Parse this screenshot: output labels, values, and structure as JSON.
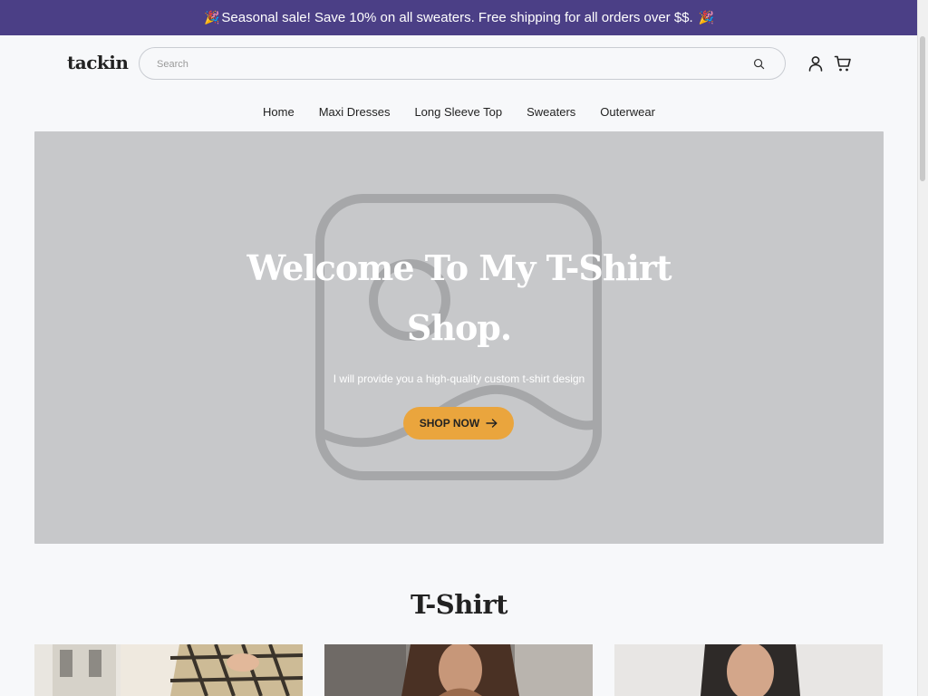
{
  "announcement": {
    "text": "Seasonal sale! Save 10% on all sweaters. Free shipping for all orders over $$.",
    "icon_left": "party-popper-icon",
    "icon_right": "party-popper-icon"
  },
  "header": {
    "logo": "tackin",
    "search": {
      "placeholder": "Search",
      "value": ""
    },
    "icons": [
      "search-icon",
      "account-icon",
      "cart-icon"
    ]
  },
  "nav": {
    "items": [
      {
        "label": "Home"
      },
      {
        "label": "Maxi Dresses"
      },
      {
        "label": "Long Sleeve Top"
      },
      {
        "label": "Sweaters"
      },
      {
        "label": "Outerwear"
      }
    ]
  },
  "hero": {
    "title_line1": "Welcome To My T-Shirt",
    "title_line2": "Shop.",
    "subtitle": "I will provide you a high-quality custom t-shirt design",
    "cta_label": "SHOP NOW",
    "cta_icon": "arrow-right-icon",
    "background_icon": "image-placeholder-icon"
  },
  "collection": {
    "title": "T-Shirt",
    "products": [
      {
        "image": "plaid-shirt-photo"
      },
      {
        "image": "brown-top-photo"
      },
      {
        "image": "white-top-photo"
      }
    ]
  },
  "colors": {
    "announcement_bg": "#4b3f86",
    "hero_bg": "#c7c8ca",
    "cta_bg": "#eaa53d",
    "page_bg": "#f7f8fa"
  }
}
